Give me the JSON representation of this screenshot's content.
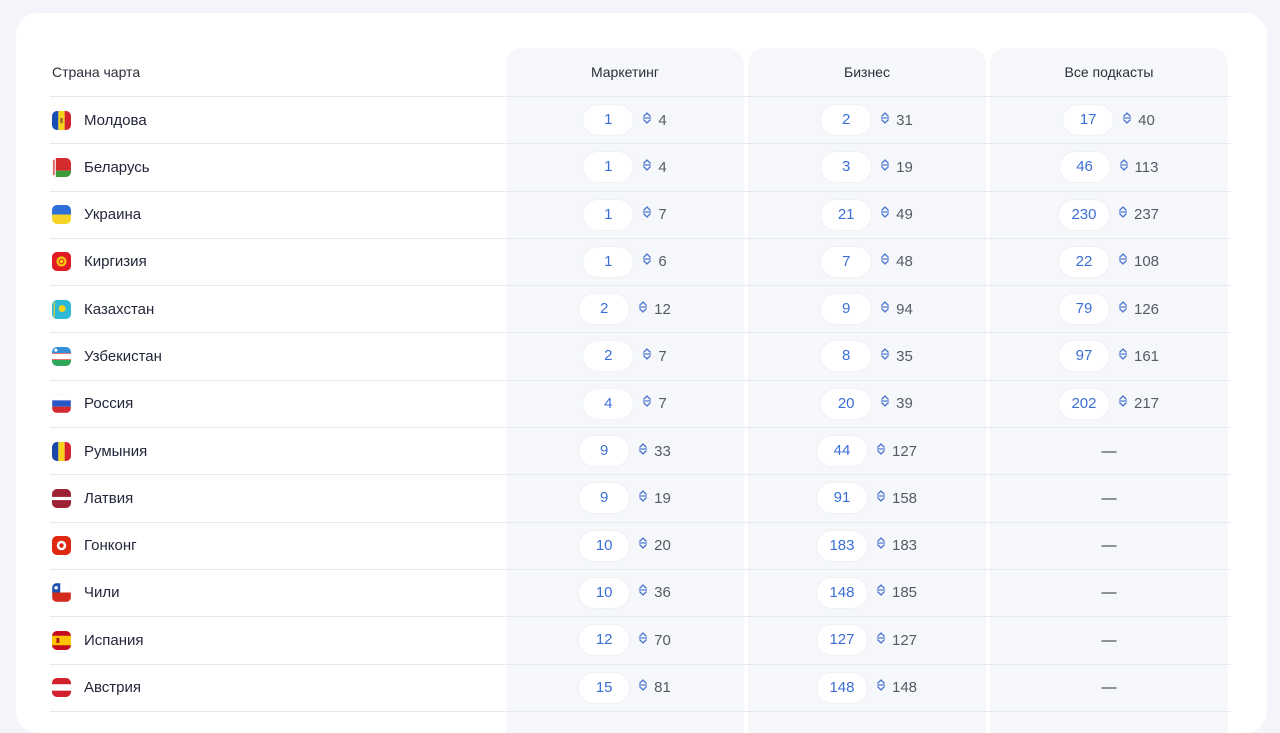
{
  "headers": {
    "country": "Страна чарта",
    "marketing": "Маркетинг",
    "business": "Бизнес",
    "all": "Все подкасты"
  },
  "rows": [
    {
      "country": "Молдова",
      "flag": "moldova",
      "marketing": {
        "pos": "1",
        "best": "4"
      },
      "business": {
        "pos": "2",
        "best": "31"
      },
      "all": {
        "pos": "17",
        "best": "40"
      }
    },
    {
      "country": "Беларусь",
      "flag": "belarus",
      "marketing": {
        "pos": "1",
        "best": "4"
      },
      "business": {
        "pos": "3",
        "best": "19"
      },
      "all": {
        "pos": "46",
        "best": "113"
      }
    },
    {
      "country": "Украина",
      "flag": "ukraine",
      "marketing": {
        "pos": "1",
        "best": "7"
      },
      "business": {
        "pos": "21",
        "best": "49"
      },
      "all": {
        "pos": "230",
        "best": "237"
      }
    },
    {
      "country": "Киргизия",
      "flag": "kyrgyzstan",
      "marketing": {
        "pos": "1",
        "best": "6"
      },
      "business": {
        "pos": "7",
        "best": "48"
      },
      "all": {
        "pos": "22",
        "best": "108"
      }
    },
    {
      "country": "Казахстан",
      "flag": "kazakhstan",
      "marketing": {
        "pos": "2",
        "best": "12"
      },
      "business": {
        "pos": "9",
        "best": "94"
      },
      "all": {
        "pos": "79",
        "best": "126"
      }
    },
    {
      "country": "Узбекистан",
      "flag": "uzbekistan",
      "marketing": {
        "pos": "2",
        "best": "7"
      },
      "business": {
        "pos": "8",
        "best": "35"
      },
      "all": {
        "pos": "97",
        "best": "161"
      }
    },
    {
      "country": "Россия",
      "flag": "russia",
      "marketing": {
        "pos": "4",
        "best": "7"
      },
      "business": {
        "pos": "20",
        "best": "39"
      },
      "all": {
        "pos": "202",
        "best": "217"
      }
    },
    {
      "country": "Румыния",
      "flag": "romania",
      "marketing": {
        "pos": "9",
        "best": "33"
      },
      "business": {
        "pos": "44",
        "best": "127"
      },
      "all": null
    },
    {
      "country": "Латвия",
      "flag": "latvia",
      "marketing": {
        "pos": "9",
        "best": "19"
      },
      "business": {
        "pos": "91",
        "best": "158"
      },
      "all": null
    },
    {
      "country": "Гонконг",
      "flag": "hongkong",
      "marketing": {
        "pos": "10",
        "best": "20"
      },
      "business": {
        "pos": "183",
        "best": "183"
      },
      "all": null
    },
    {
      "country": "Чили",
      "flag": "chile",
      "marketing": {
        "pos": "10",
        "best": "36"
      },
      "business": {
        "pos": "148",
        "best": "185"
      },
      "all": null
    },
    {
      "country": "Испания",
      "flag": "spain",
      "marketing": {
        "pos": "12",
        "best": "70"
      },
      "business": {
        "pos": "127",
        "best": "127"
      },
      "all": null
    },
    {
      "country": "Австрия",
      "flag": "austria",
      "marketing": {
        "pos": "15",
        "best": "81"
      },
      "business": {
        "pos": "148",
        "best": "148"
      },
      "all": null
    }
  ],
  "empty_value": "—",
  "colors": {
    "accent": "#3b6fd6",
    "column_bg": "#f5f7fb",
    "page_bg": "#f3f5fa"
  }
}
